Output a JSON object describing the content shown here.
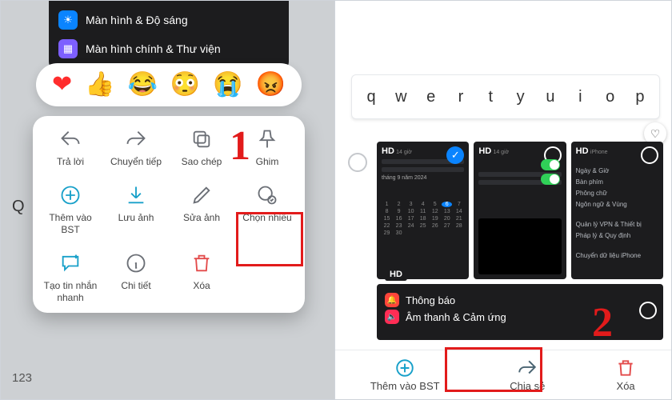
{
  "left": {
    "settings_rows": [
      {
        "icon": "brightness-icon",
        "label": "Màn hình & Độ sáng"
      },
      {
        "icon": "home-icon",
        "label": "Màn hình chính & Thư viện"
      }
    ],
    "reactions": [
      "❤",
      "👍",
      "😂",
      "😳",
      "😭",
      "😡"
    ],
    "menu": [
      {
        "key": "reply",
        "label": "Trả lời",
        "icon": "reply-icon"
      },
      {
        "key": "forward",
        "label": "Chuyển tiếp",
        "icon": "forward-icon"
      },
      {
        "key": "copy",
        "label": "Sao chép",
        "icon": "copy-icon"
      },
      {
        "key": "pin",
        "label": "Ghim",
        "icon": "pin-icon"
      },
      {
        "key": "addbst",
        "label": "Thêm vào BST",
        "icon": "add-circle-icon",
        "accent": true
      },
      {
        "key": "saveimg",
        "label": "Lưu ảnh",
        "icon": "download-icon",
        "accent": true
      },
      {
        "key": "editimg",
        "label": "Sửa ảnh",
        "icon": "pencil-icon"
      },
      {
        "key": "multi",
        "label": "Chọn nhiều",
        "icon": "multi-select-icon"
      },
      {
        "key": "quickmsg",
        "label": "Tạo tin nhắn nhanh",
        "icon": "chat-plus-icon",
        "accent": true
      },
      {
        "key": "detail",
        "label": "Chi tiết",
        "icon": "info-icon"
      },
      {
        "key": "delete",
        "label": "Xóa",
        "icon": "trash-icon",
        "danger": true
      }
    ],
    "annotation_number": "1",
    "kb_hint": "Q",
    "kb_123": "123"
  },
  "right": {
    "keyboard_row": [
      "q",
      "w",
      "e",
      "r",
      "t",
      "y",
      "u",
      "i",
      "o",
      "p"
    ],
    "fav_glyph": "♡",
    "thumbs": [
      {
        "hd": "HD",
        "selected_check": true,
        "sub": "14 giờ",
        "kind": "calendar"
      },
      {
        "hd": "HD",
        "selected_check": false,
        "sub": "14 giờ",
        "kind": "toggles"
      },
      {
        "hd": "HD",
        "selected_check": false,
        "sub": "iPhone",
        "kind": "list"
      }
    ],
    "thumb_list_items": [
      "Ngày & Giờ",
      "Bàn phím",
      "Phông chữ",
      "Ngôn ngữ & Vùng",
      "Quản lý VPN & Thiết bị",
      "Pháp lý & Quy định",
      "Chuyển dữ liệu iPhone"
    ],
    "calendar": {
      "header": "tháng 9 năm 2024",
      "today": 6,
      "days": [
        1,
        2,
        3,
        4,
        5,
        6,
        7,
        8,
        9,
        10,
        11,
        12,
        13,
        14,
        15,
        16,
        17,
        18,
        19,
        20,
        21,
        22,
        23,
        24,
        25,
        26,
        27,
        28,
        29,
        30
      ]
    },
    "row2_hd": "HD",
    "row2_items": [
      {
        "icon": "bell-icon",
        "label": "Thông báo"
      },
      {
        "icon": "sound-icon",
        "label": "Âm thanh & Cảm ứng"
      }
    ],
    "actions": [
      {
        "key": "addbst",
        "label": "Thêm vào BST",
        "icon": "add-circle-icon",
        "color": "#18a0c9"
      },
      {
        "key": "share",
        "label": "Chia sẻ",
        "icon": "share-icon",
        "color": "#4a6472"
      },
      {
        "key": "delete",
        "label": "Xóa",
        "icon": "trash-icon",
        "color": "#e34b4b"
      }
    ],
    "annotation_number": "2"
  }
}
